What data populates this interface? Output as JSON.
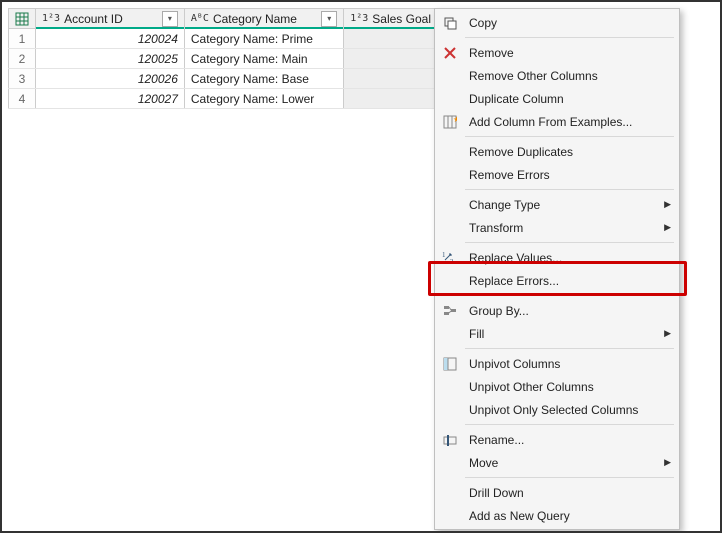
{
  "columns": {
    "account": {
      "type_icon": "1²3",
      "label": "Account ID"
    },
    "category": {
      "type_icon": "AᴮC",
      "label": "Category Name"
    },
    "sales": {
      "type_icon": "1²3",
      "label": "Sales Goal"
    }
  },
  "rows": [
    {
      "n": "1",
      "account": "120024",
      "category": "Category Name: Prime"
    },
    {
      "n": "2",
      "account": "120025",
      "category": "Category Name: Main"
    },
    {
      "n": "3",
      "account": "120026",
      "category": "Category Name: Base"
    },
    {
      "n": "4",
      "account": "120027",
      "category": "Category Name: Lower"
    }
  ],
  "menu": {
    "copy": "Copy",
    "remove": "Remove",
    "remove_other": "Remove Other Columns",
    "duplicate": "Duplicate Column",
    "add_examples": "Add Column From Examples...",
    "remove_dupes": "Remove Duplicates",
    "remove_errors": "Remove Errors",
    "change_type": "Change Type",
    "transform": "Transform",
    "replace_values": "Replace Values...",
    "replace_errors": "Replace Errors...",
    "group_by": "Group By...",
    "fill": "Fill",
    "unpivot": "Unpivot Columns",
    "unpivot_other": "Unpivot Other Columns",
    "unpivot_sel": "Unpivot Only Selected Columns",
    "rename": "Rename...",
    "move": "Move",
    "drill": "Drill Down",
    "add_query": "Add as New Query"
  }
}
